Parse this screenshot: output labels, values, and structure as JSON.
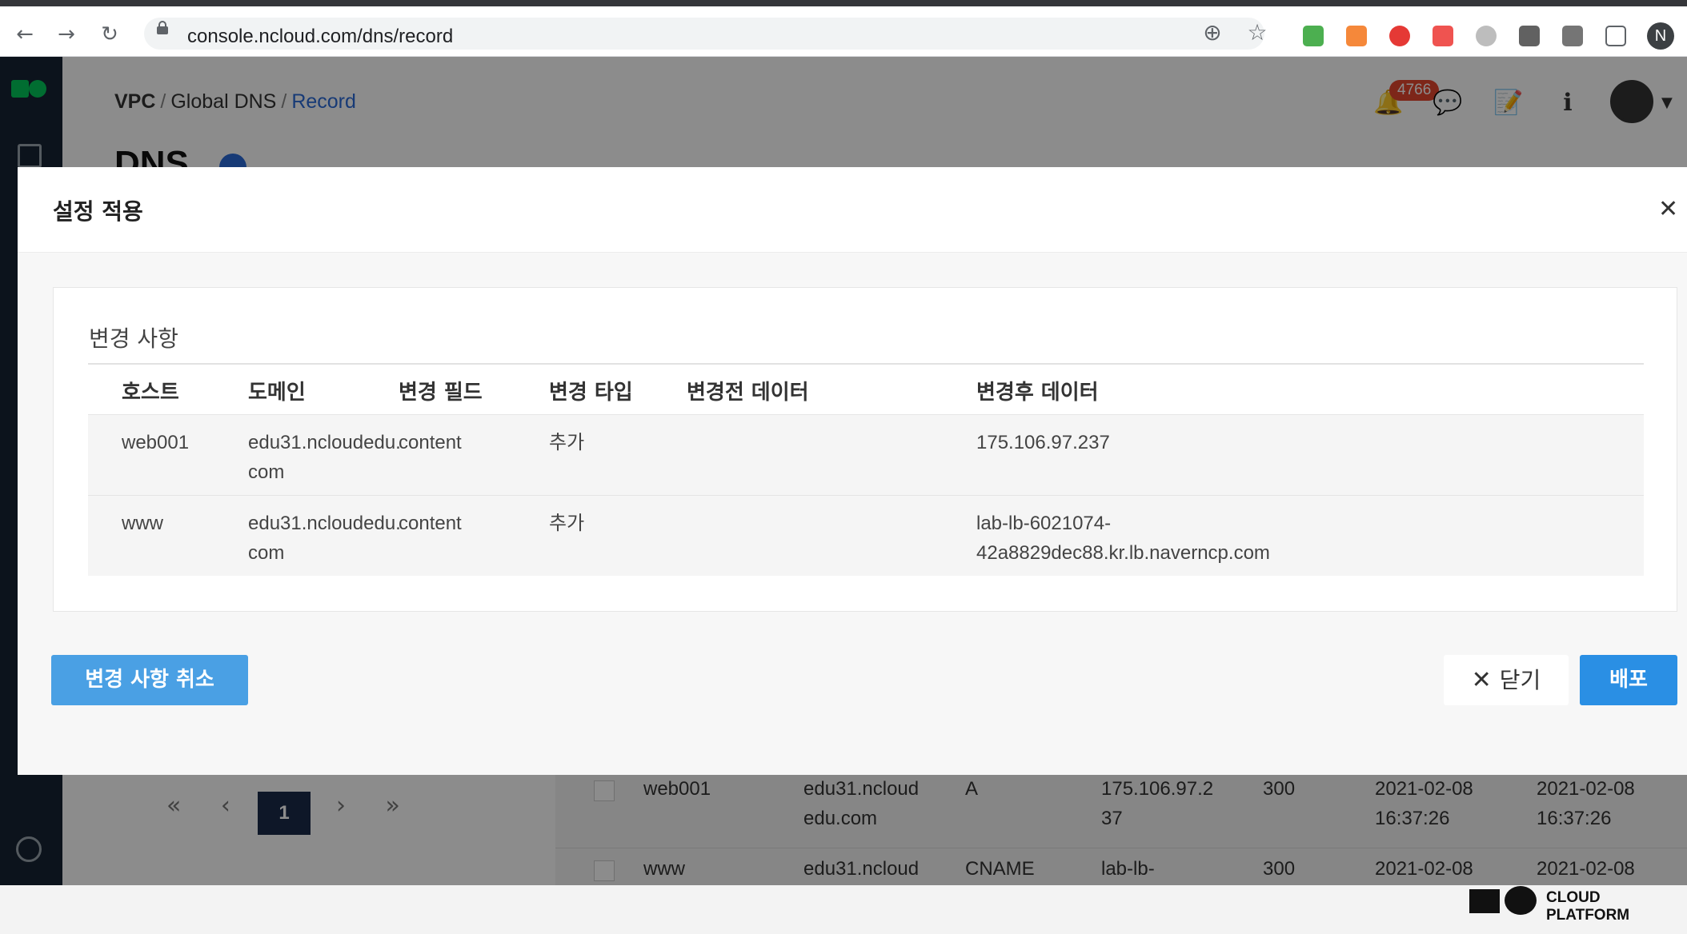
{
  "browser": {
    "url": "console.ncloud.com/dns/record",
    "back_icon": "←",
    "forward_icon": "→",
    "reload_icon": "↻",
    "zoom_icon": "⊕",
    "star_icon": "☆",
    "profile_initial": "N"
  },
  "app": {
    "breadcrumb": [
      "VPC",
      "Global DNS",
      "Record"
    ],
    "page_title": "DNS",
    "notification_count": "4766",
    "pagination": {
      "current": "1",
      "first": "«",
      "prev": "‹",
      "next": "›",
      "last": "»"
    },
    "background_rows": [
      {
        "host": "web001",
        "domain_1": "edu31.ncloud",
        "domain_2": "edu.com",
        "type": "A",
        "value_1": "175.106.97.2",
        "value_2": "37",
        "ttl": "300",
        "created_1": "2021-02-08",
        "created_2": "16:37:26",
        "updated_1": "2021-02-08",
        "updated_2": "16:37:26"
      },
      {
        "host": "www",
        "domain_1": "edu31.ncloud",
        "domain_2": "",
        "type": "CNAME",
        "value_1": "lab-lb-",
        "value_2": "",
        "ttl": "300",
        "created_1": "2021-02-08",
        "created_2": "",
        "updated_1": "2021-02-08",
        "updated_2": ""
      }
    ],
    "footer_brand": "CLOUD PLATFORM"
  },
  "modal": {
    "title": "설정 적용",
    "close_icon": "✕",
    "section_title": "변경 사항",
    "columns": [
      "호스트",
      "도메인",
      "변경 필드",
      "변경 타입",
      "변경전 데이터",
      "변경후 데이터"
    ],
    "rows": [
      {
        "host": "web001",
        "domain_1": "edu31.ncloudedu.",
        "domain_2": "com",
        "field": "content",
        "change_type": "추가",
        "before": "",
        "after_1": "175.106.97.237",
        "after_2": ""
      },
      {
        "host": "www",
        "domain_1": "edu31.ncloudedu.",
        "domain_2": "com",
        "field": "content",
        "change_type": "추가",
        "before": "",
        "after_1": "lab-lb-6021074-",
        "after_2": "42a8829dec88.kr.lb.naverncp.com"
      }
    ],
    "buttons": {
      "cancel_changes": "변경 사항 취소",
      "close": "닫기",
      "close_icon": "✕",
      "deploy": "배포"
    }
  },
  "colors": {
    "primary_button": "#2a8fe4",
    "secondary_button": "#4aa0e4",
    "sidebar": "#162433",
    "brand_green": "#03c75a"
  }
}
